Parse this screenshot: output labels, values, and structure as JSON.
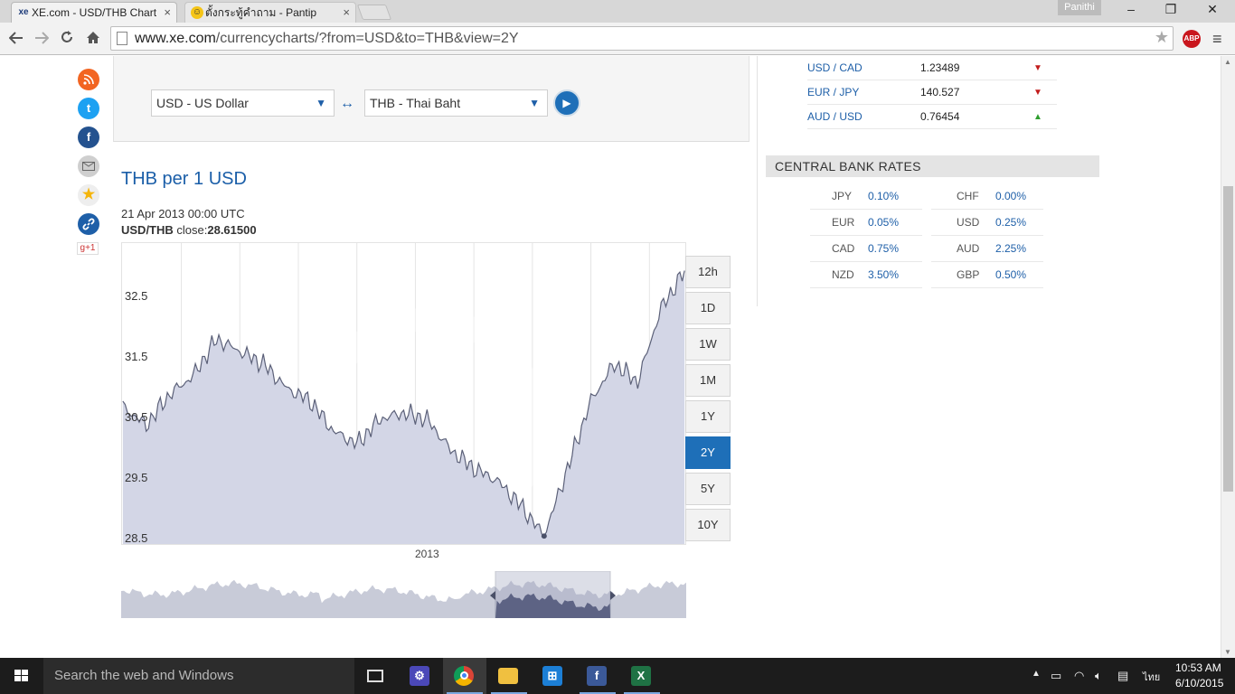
{
  "browser": {
    "tabs": [
      {
        "title": "XE.com - USD/THB Chart",
        "icon": "xe-favicon"
      },
      {
        "title": "ตั้งกระทู้คำถาม - Pantip",
        "icon": "pantip-favicon"
      }
    ],
    "profile_name": "Panithi",
    "url_host": "www.xe.com",
    "url_path": "/currencycharts/?from=USD&to=THB&view=2Y",
    "abp_label": "ABP"
  },
  "converter": {
    "from_currency": "USD - US Dollar",
    "to_currency": "THB - Thai Baht",
    "swap_symbol": "↔"
  },
  "chart": {
    "title": "THB per 1 USD",
    "hover_date": "21 Apr 2013 00:00 UTC",
    "close_label": "USD/THB",
    "close_word": " close:",
    "close_value": "28.61500",
    "y_ticks": [
      "32.5",
      "31.5",
      "30.5",
      "29.5",
      "28.5"
    ],
    "x_tick": "2013",
    "ranges": [
      {
        "label": "12h",
        "active": false
      },
      {
        "label": "1D",
        "active": false
      },
      {
        "label": "1W",
        "active": false
      },
      {
        "label": "1M",
        "active": false
      },
      {
        "label": "1Y",
        "active": false
      },
      {
        "label": "2Y",
        "active": true
      },
      {
        "label": "5Y",
        "active": false
      },
      {
        "label": "10Y",
        "active": false
      }
    ]
  },
  "chart_data": {
    "type": "area",
    "title": "THB per 1 USD",
    "xlabel": "",
    "ylabel": "",
    "ylim": [
      28.5,
      33.3
    ],
    "grid": true,
    "x": [
      "2012-06",
      "2012-07",
      "2012-08",
      "2012-09",
      "2012-10",
      "2012-11",
      "2012-12",
      "2013-01",
      "2013-02",
      "2013-03",
      "2013-04",
      "2013-05",
      "2013-06",
      "2013-07",
      "2013-08",
      "2013-09",
      "2013-10",
      "2013-11",
      "2013-12",
      "2014-01",
      "2014-02",
      "2014-03",
      "2014-04",
      "2014-05",
      "2014-06"
    ],
    "series": [
      {
        "values": [
          30.7,
          30.4,
          30.9,
          31.2,
          31.8,
          31.6,
          31.4,
          31.0,
          30.8,
          30.3,
          30.1,
          30.5,
          30.6,
          30.5,
          30.0,
          29.7,
          29.5,
          29.1,
          28.6,
          29.7,
          30.8,
          31.4,
          31.1,
          32.3,
          32.9
        ]
      }
    ]
  },
  "rates": [
    {
      "pair": "USD / CAD",
      "value": "1.23489",
      "trend": "down"
    },
    {
      "pair": "EUR / JPY",
      "value": "140.527",
      "trend": "down"
    },
    {
      "pair": "AUD / USD",
      "value": "0.76454",
      "trend": "up"
    }
  ],
  "central_bank": {
    "header": "CENTRAL BANK RATES",
    "rates": [
      {
        "code": "JPY",
        "rate": "0.10%"
      },
      {
        "code": "CHF",
        "rate": "0.00%"
      },
      {
        "code": "EUR",
        "rate": "0.05%"
      },
      {
        "code": "USD",
        "rate": "0.25%"
      },
      {
        "code": "CAD",
        "rate": "0.75%"
      },
      {
        "code": "AUD",
        "rate": "2.25%"
      },
      {
        "code": "NZD",
        "rate": "3.50%"
      },
      {
        "code": "GBP",
        "rate": "0.50%"
      }
    ]
  },
  "taskbar": {
    "search_placeholder": "Search the web and Windows",
    "time": "10:53 AM",
    "date": "6/10/2015",
    "language": "ไทย"
  },
  "colors": {
    "accent": "#1e6fb8",
    "link": "#1e5fa8",
    "chart_fill": "#d3d6e6",
    "chart_line": "#5b6078",
    "trend_down": "#c21c1c",
    "trend_up": "#2e9e2e"
  }
}
